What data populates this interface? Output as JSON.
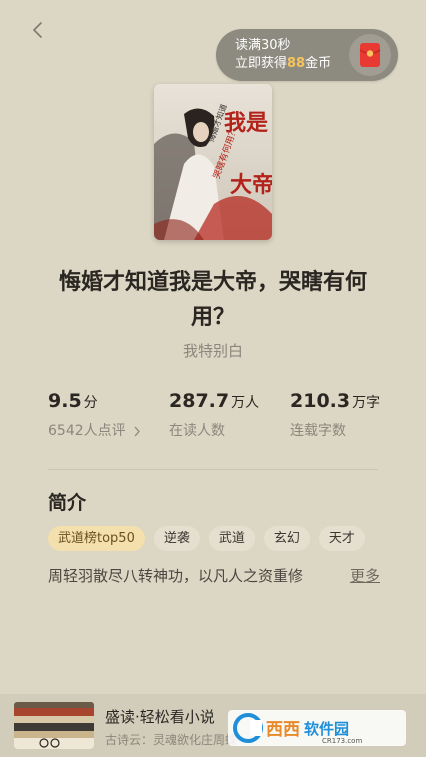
{
  "reward": {
    "line1": "读满30秒",
    "line2_prefix": "立即获得",
    "line2_amount": "88",
    "line2_suffix": "金币",
    "icon": "red-envelope-icon"
  },
  "book": {
    "title": "悔婚才知道我是大帝，哭瞎有何用？",
    "author": "我特别白",
    "cover_text": {
      "main": "我是大帝",
      "sub": "哭瞎有何用？",
      "side": "悔婚才知道"
    }
  },
  "stats": [
    {
      "value": "9.5",
      "unit": "分",
      "label": "6542人点评",
      "chevron": true
    },
    {
      "value": "287.7",
      "unit": "万人",
      "label": "在读人数",
      "chevron": false
    },
    {
      "value": "210.3",
      "unit": "万字",
      "label": "连载字数",
      "chevron": false
    }
  ],
  "intro": {
    "heading": "简介",
    "tags": [
      "武道榜top50",
      "逆袭",
      "武道",
      "玄幻",
      "天才"
    ],
    "text": "周轻羽散尽八转神功，以凡人之资重修",
    "more_label": "更多"
  },
  "banner": {
    "title": "盛读·轻松看小说",
    "subtitle": "古诗云：灵魂欲化庄周蝶"
  },
  "watermark": {
    "brand": "西西软件园",
    "domain": "CR173.com"
  },
  "colors": {
    "background": "#dcd6c4",
    "accent_gold": "#f6c45a",
    "highlight_tag": "#f4e0ad",
    "envelope_red": "#e83a32"
  }
}
